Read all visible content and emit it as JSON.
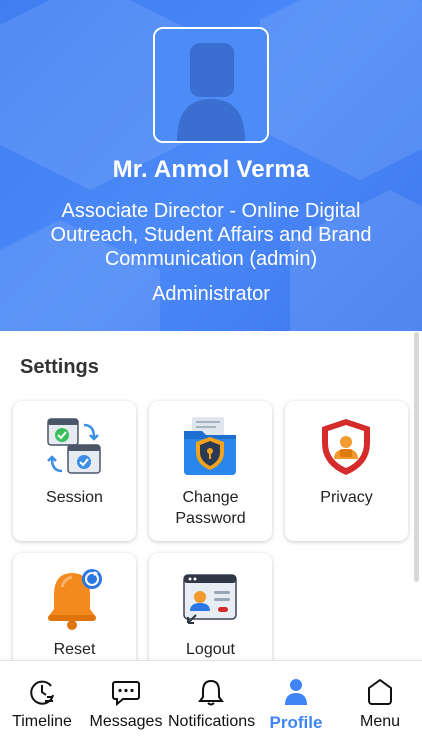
{
  "profile": {
    "name": "Mr. Anmol Verma",
    "title": "Associate Director - Online Digital Outreach, Student Affairs and Brand Communication (admin)",
    "role": "Administrator"
  },
  "settings": {
    "heading": "Settings",
    "cards": [
      {
        "label": "Session",
        "icon": "session-icon"
      },
      {
        "label": "Change Password",
        "icon": "change-password-icon"
      },
      {
        "label": "Privacy",
        "icon": "privacy-shield-icon"
      },
      {
        "label": "Reset",
        "icon": "reset-bell-icon"
      },
      {
        "label": "Logout",
        "icon": "logout-icon"
      }
    ]
  },
  "nav": {
    "items": [
      {
        "label": "Timeline",
        "icon": "timeline-icon"
      },
      {
        "label": "Messages",
        "icon": "messages-icon"
      },
      {
        "label": "Notifications",
        "icon": "bell-icon"
      },
      {
        "label": "Profile",
        "icon": "profile-icon"
      },
      {
        "label": "Menu",
        "icon": "home-icon"
      }
    ],
    "active": "Profile"
  },
  "colors": {
    "header_blue": "#4285f4",
    "accent": "#3f86f4"
  }
}
